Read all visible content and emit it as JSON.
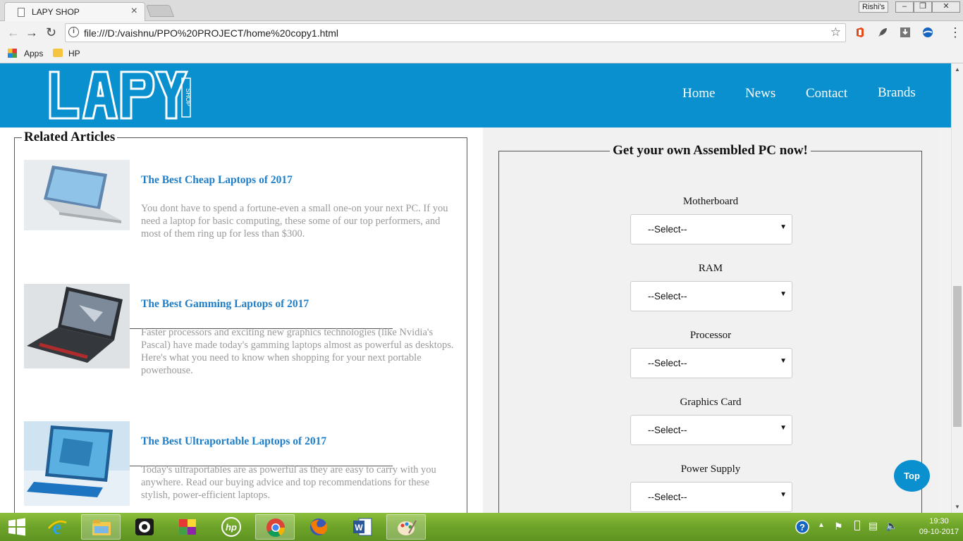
{
  "browser": {
    "tab_title": "LAPY SHOP",
    "tab_close": "×",
    "profile_name": "Rishi's",
    "url": "file:///D:/vaishnu/PPO%20PROJECT/home%20copy1.html",
    "bookmarks": [
      "Apps",
      "HP"
    ],
    "window_buttons": [
      "–",
      "❐",
      "✕"
    ],
    "icons": [
      "back-icon",
      "forward-icon",
      "reload-icon",
      "info-icon",
      "star-icon",
      "office-icon",
      "rocket-icon",
      "download-icon",
      "globe-icon",
      "menu-icon"
    ]
  },
  "site": {
    "logo_text": "LAPY",
    "logo_sub": "SHOP",
    "nav": [
      "Home",
      "News",
      "Contact",
      "Brands"
    ],
    "accent_color": "#0a8fcf"
  },
  "articles": {
    "legend": "Related Articles",
    "items": [
      {
        "title": "The Best Cheap Laptops of 2017",
        "text": "You dont have to spend a fortune-even a small one-on your next PC. If you need a laptop for basic computing, these some of our top performers, and most of them ring up for less than $300.",
        "thumb": "laptop-silver-image"
      },
      {
        "title": "The Best Gamming Laptops of 2017",
        "text": "Faster processors and exciting new graphics technologies (like Nvidia's Pascal) have made today's gamming laptops almost as powerful as desktops. Here's what you need to know when shopping for your next portable powerhouse.",
        "thumb": "gaming-laptop-image"
      },
      {
        "title": "The Best Ultraportable Laptops of 2017",
        "text": "Today's ultraportables are as powerful as they are easy to carry with you anywhere. Read our buying advice and top recommendations for these stylish, power-efficient laptops.",
        "thumb": "tablet-laptop-image"
      }
    ]
  },
  "builder": {
    "legend": "Get your own Assembled PC now!",
    "fields": [
      {
        "label": "Motherboard",
        "value": "--Select--"
      },
      {
        "label": "RAM",
        "value": "--Select--"
      },
      {
        "label": "Processor",
        "value": "--Select--"
      },
      {
        "label": "Graphics Card",
        "value": "--Select--"
      },
      {
        "label": "Power Supply",
        "value": "--Select--"
      }
    ],
    "arrow": "▼"
  },
  "top_button": "Top",
  "taskbar": {
    "apps": [
      "start-icon",
      "internet-explorer-icon",
      "file-explorer-icon",
      "camera-icon",
      "paint-app-icon",
      "hp-icon",
      "chrome-icon",
      "firefox-icon",
      "word-icon",
      "paint-palette-icon"
    ],
    "time": "19:30",
    "date": "09-10-2017"
  }
}
